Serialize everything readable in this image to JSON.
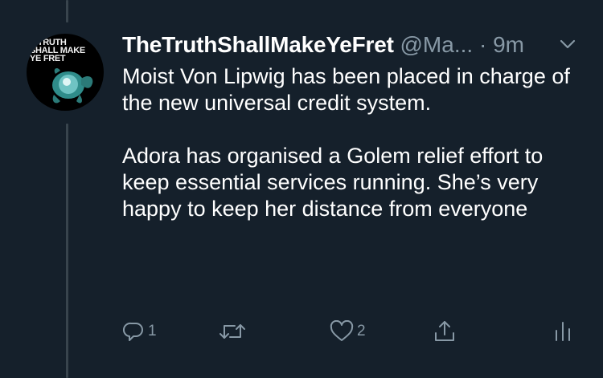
{
  "tweet": {
    "avatar_text": [
      "E TRUTH",
      "SHALL MAKE",
      "YE FRET"
    ],
    "display_name": "TheTruthShallMakeYeFret",
    "handle": "@Ma...",
    "separator": "·",
    "time": "9m",
    "paragraphs": [
      "Moist Von Lipwig has been placed in charge of the new universal credit system.",
      "Adora has organised a Golem relief effort to keep essential services running. She’s very happy to keep her distance from everyone"
    ],
    "reply_count": "1",
    "retweet_count": "",
    "like_count": "2"
  },
  "icons": {
    "reply": "reply-icon",
    "retweet": "retweet-icon",
    "like": "heart-icon",
    "share": "share-icon",
    "analytics": "analytics-icon",
    "more": "chevron-down-icon"
  },
  "colors": {
    "background": "#15202b",
    "text_primary": "#ffffff",
    "text_secondary": "#8899a6",
    "thread_line": "#38444d"
  }
}
